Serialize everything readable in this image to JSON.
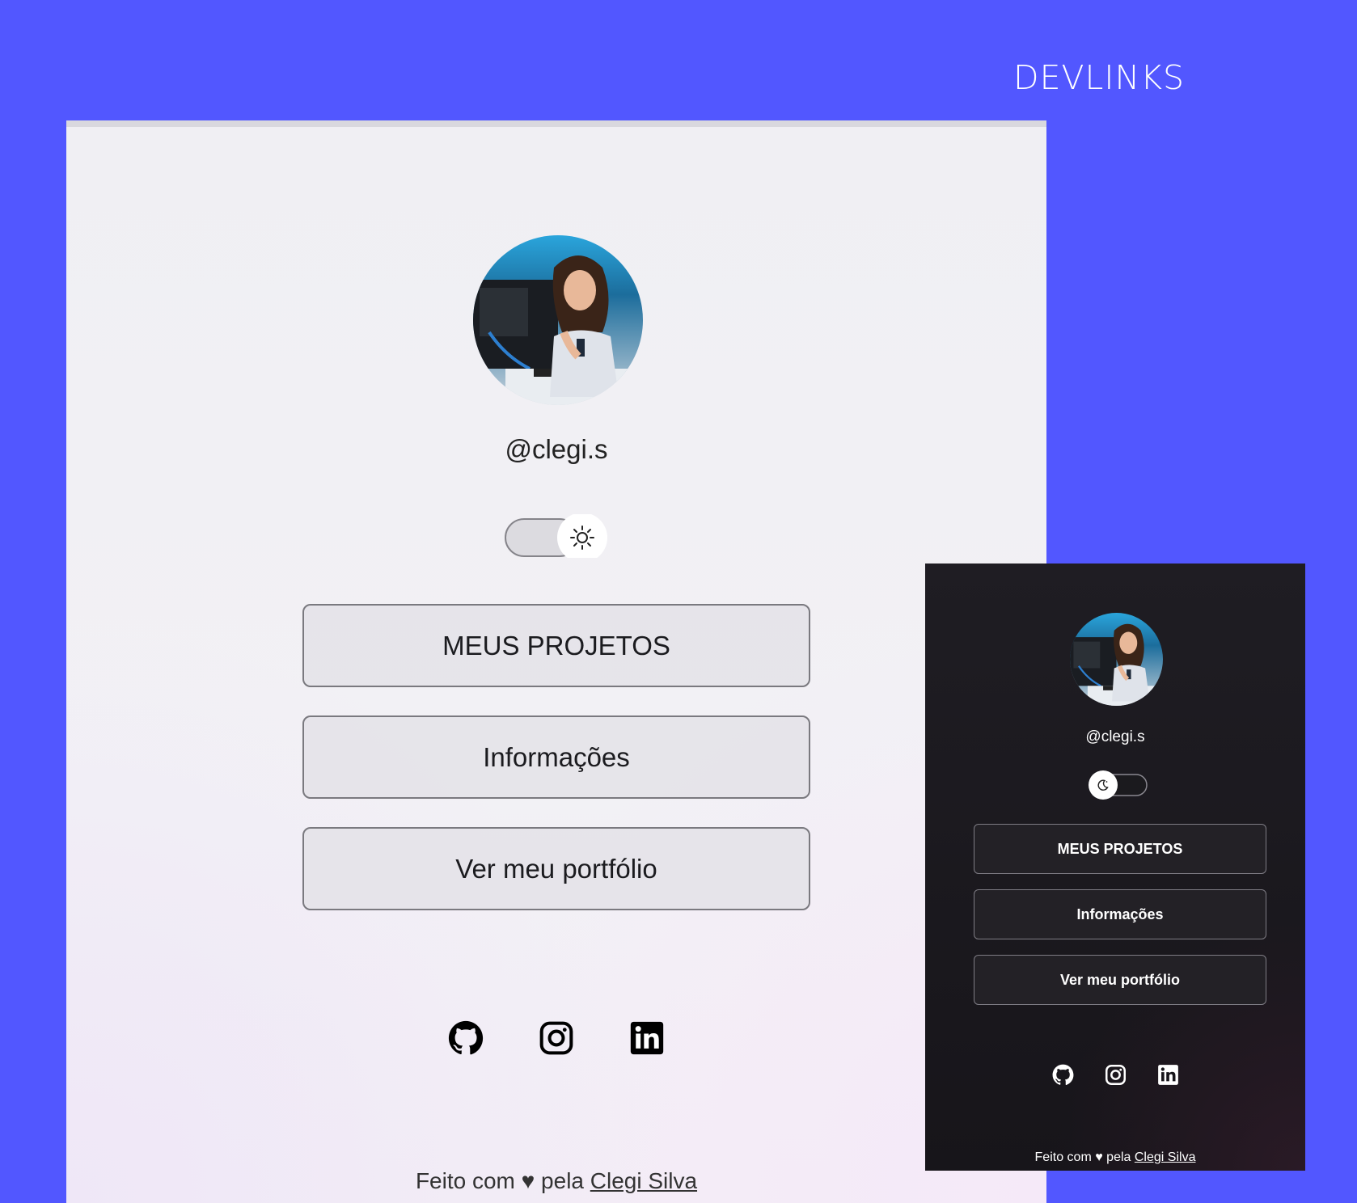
{
  "page": {
    "brand": "DEVLINKS",
    "bg_color": "#5257ff"
  },
  "light_preview": {
    "handle": "@clegi.s",
    "theme_toggle": {
      "state": "light",
      "icon": "sun-icon"
    },
    "links": [
      {
        "label": "MEUS PROJETOS"
      },
      {
        "label": "Informações"
      },
      {
        "label": "Ver meu portfólio"
      }
    ],
    "socials": [
      {
        "name": "github-icon"
      },
      {
        "name": "instagram-icon"
      },
      {
        "name": "linkedin-icon"
      }
    ],
    "footer": {
      "prefix": "Feito com ♥ pela",
      "author": "Clegi Silva"
    }
  },
  "dark_preview": {
    "handle": "@clegi.s",
    "theme_toggle": {
      "state": "dark",
      "icon": "moon-icon"
    },
    "links": [
      {
        "label": "MEUS PROJETOS"
      },
      {
        "label": "Informações"
      },
      {
        "label": "Ver meu portfólio"
      }
    ],
    "socials": [
      {
        "name": "github-icon"
      },
      {
        "name": "instagram-icon"
      },
      {
        "name": "linkedin-icon"
      }
    ],
    "footer": {
      "prefix": "Feito com ♥ pela",
      "author": "Clegi Silva"
    }
  }
}
